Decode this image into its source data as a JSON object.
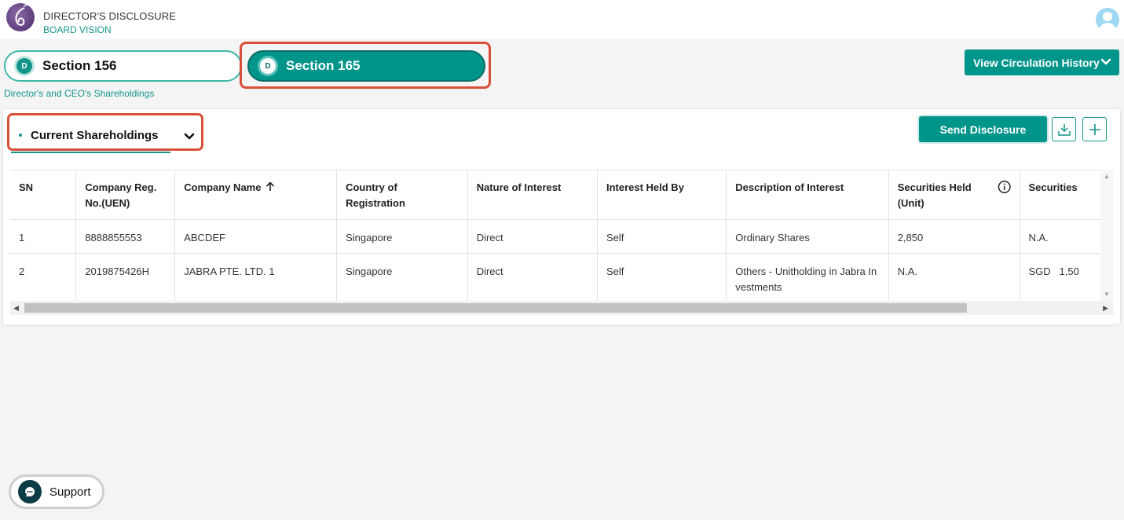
{
  "header": {
    "app_title": "DIRECTOR'S DISCLOSURE",
    "app_subtitle": "BOARD VISION",
    "avatar_icon": "user-icon"
  },
  "sections": {
    "tabs": [
      {
        "badge": "D",
        "label": "Section 156",
        "active": false
      },
      {
        "badge": "D",
        "label": "Section 165",
        "active": true
      }
    ],
    "caption": "Director's and CEO's Shareholdings",
    "view_history_label": "View Circulation History"
  },
  "card": {
    "dropdown_label": "Current Shareholdings",
    "send_label": "Send Disclosure",
    "download_icon": "download-icon",
    "add_icon": "plus-icon"
  },
  "table": {
    "columns": [
      "SN",
      "Company Reg. No.(UEN)",
      "Company Name",
      "Country of Registration",
      "Nature of Interest",
      "Interest Held By",
      "Description of Interest",
      "Securities Held (Unit)",
      "Securities"
    ],
    "rows": [
      [
        "1",
        "8888855553",
        "ABCDEF",
        "Singapore",
        "Direct",
        "Self",
        "Ordinary Shares",
        "2,850",
        "N.A."
      ],
      [
        "2",
        "2019875426H",
        "JABRA PTE. LTD. 1",
        "Singapore",
        "Direct",
        "Self",
        "Others - Unitholding in Jabra In vestments",
        "N.A.",
        "SGD   1,50"
      ]
    ]
  },
  "support": {
    "label": "Support",
    "icon": "chat-icon"
  },
  "colors": {
    "accent": "#00958b",
    "highlight": "#d9503a"
  }
}
